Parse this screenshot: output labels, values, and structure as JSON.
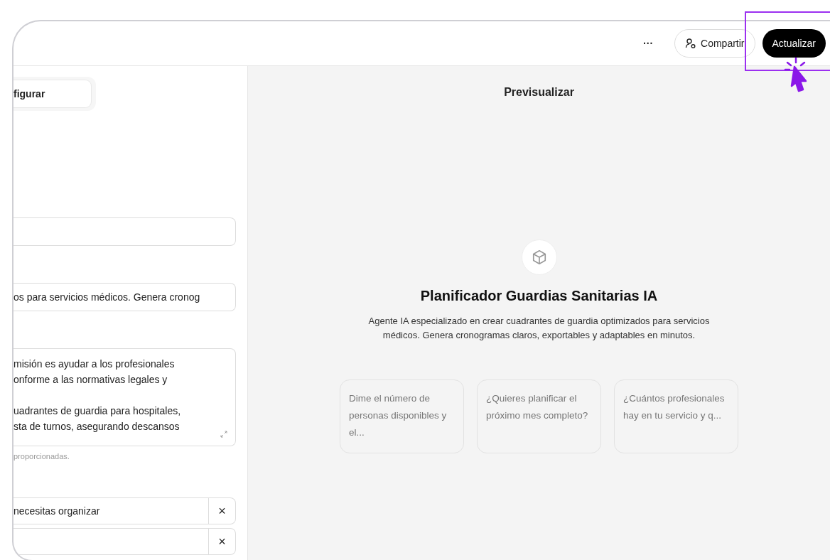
{
  "header": {
    "more": "···",
    "share": "Compartir",
    "update": "Actualizar"
  },
  "config": {
    "tab": "figurar",
    "fields": [
      {
        "kind": "input"
      },
      {
        "kind": "input",
        "value": "os para servicios médicos. Genera cronog"
      },
      {
        "kind": "textarea",
        "paragraphs": [
          [
            "misión es ayudar a los profesionales",
            "onforme a las normativas legales y"
          ],
          [
            "uadrantes de guardia para hospitales,",
            "sta de turnos, asegurando descansos"
          ]
        ],
        "hint": "proporcionadas."
      }
    ],
    "starters": [
      {
        "value": "necesitas organizar",
        "remove": "×"
      },
      {
        "remove": "×"
      }
    ]
  },
  "preview": {
    "title": "Previsualizar",
    "agent_name": "Planificador Guardias Sanitarias IA",
    "description": "Agente IA especializado en crear cuadrantes de guardia optimizados para servicios médicos. Genera cronogramas claros, exportables y adaptables en minutos.",
    "suggestions": [
      "Dime el número de personas disponibles y el...",
      "¿Quieres planificar el próximo mes completo?",
      "¿Cuántos profesionales hay en tu servicio y q..."
    ]
  }
}
